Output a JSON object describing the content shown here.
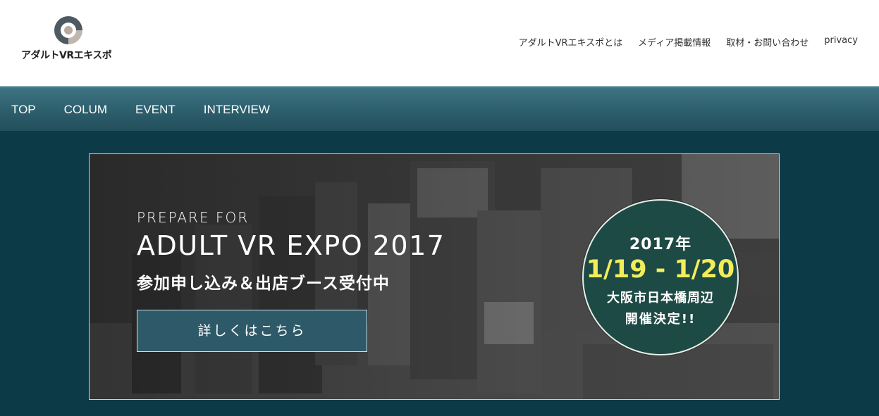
{
  "header": {
    "logo_text": "アダルトVRエキスポ",
    "util_nav": [
      {
        "label": "アダルトVRエキスポとは"
      },
      {
        "label": "メディア掲載情報"
      },
      {
        "label": "取材・お問い合わせ"
      },
      {
        "label": "privacy"
      }
    ]
  },
  "main_nav": {
    "items": [
      {
        "label": "TOP"
      },
      {
        "label": "COLUM"
      },
      {
        "label": "EVENT"
      },
      {
        "label": "INTERVIEW"
      }
    ]
  },
  "hero": {
    "kicker": "PREPARE FOR",
    "title": "ADULT VR EXPO 2017",
    "subtitle": "参加申し込み＆出店ブース受付中",
    "button_label": "詳しくはこちら",
    "badge": {
      "year": "2017年",
      "dates": "1/19 - 1/20",
      "place": "大阪市日本橋周辺",
      "note": "開催決定!!"
    }
  },
  "colors": {
    "header_bg": "#ffffff",
    "nav_bg": "#2c5e6c",
    "content_bg": "#0c3b47",
    "button_bg": "#2d5968",
    "badge_bg": "#1e4a45",
    "badge_date_color": "#f2ed5a"
  }
}
